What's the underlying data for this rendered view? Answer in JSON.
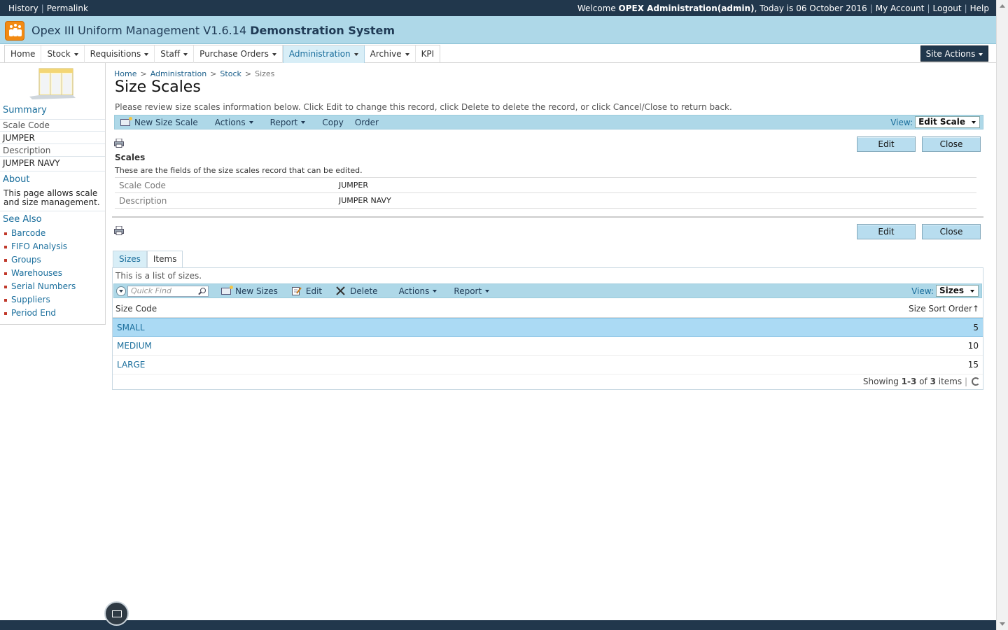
{
  "topbar": {
    "history": "History",
    "permalink": "Permalink",
    "welcome": "Welcome",
    "user": "OPEX Administration(admin)",
    "today": ", Today is 06 October 2016",
    "my_account": "My Account",
    "logout": "Logout",
    "help": "Help"
  },
  "header": {
    "app_name": "Opex III Uniform Management V1.6.14",
    "system": "Demonstration System"
  },
  "nav": {
    "items": [
      "Home",
      "Stock",
      "Requisitions",
      "Staff",
      "Purchase Orders",
      "Administration",
      "Archive",
      "KPI"
    ],
    "active": "Administration",
    "site_actions": "Site Actions"
  },
  "left": {
    "summary": "Summary",
    "scale_code_label": "Scale Code",
    "scale_code_value": "JUMPER",
    "description_label": "Description",
    "description_value": "JUMPER NAVY",
    "about": "About",
    "about_text": "This page allows scale and size management.",
    "see_also": "See Also",
    "links": [
      "Barcode",
      "FIFO Analysis",
      "Groups",
      "Warehouses",
      "Serial Numbers",
      "Suppliers",
      "Period End"
    ]
  },
  "breadcrumb": [
    "Home",
    "Administration",
    "Stock",
    "Sizes"
  ],
  "page": {
    "title": "Size Scales",
    "intro": "Please review size scales information below. Click Edit to change this record, click Delete to delete the record, or click Cancel/Close to return back."
  },
  "toolbar1": {
    "new": "New Size Scale",
    "actions": "Actions",
    "report": "Report",
    "copy": "Copy",
    "order": "Order",
    "view_label": "View:",
    "view_value": "Edit Scale"
  },
  "buttons": {
    "edit": "Edit",
    "close": "Close"
  },
  "scales": {
    "title": "Scales",
    "desc": "These are the fields of the size scales record that can be edited.",
    "fields": [
      {
        "label": "Scale Code",
        "value": "JUMPER"
      },
      {
        "label": "Description",
        "value": "JUMPER NAVY"
      }
    ]
  },
  "tabs": [
    "Sizes",
    "Items"
  ],
  "list": {
    "desc": "This is a list of sizes.",
    "quick_find": "Quick Find",
    "new": "New Sizes",
    "edit": "Edit",
    "delete": "Delete",
    "actions": "Actions",
    "report": "Report",
    "view_label": "View:",
    "view_value": "Sizes",
    "col_code": "Size Code",
    "col_sort": "Size Sort Order",
    "rows": [
      {
        "code": "SMALL",
        "sort": "5"
      },
      {
        "code": "MEDIUM",
        "sort": "10"
      },
      {
        "code": "LARGE",
        "sort": "15"
      }
    ],
    "showing": "Showing",
    "range": "1-3",
    "of": "of",
    "total": "3",
    "items": "items"
  }
}
